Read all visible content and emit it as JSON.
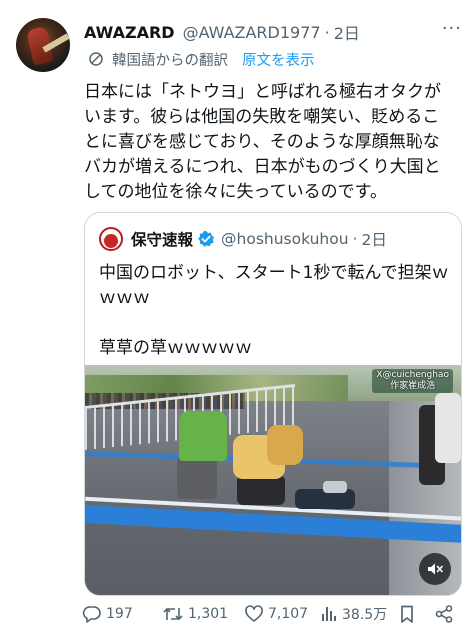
{
  "post": {
    "author_name": "AWAZARD",
    "author_handle": "@AWAZARD1977",
    "separator": "·",
    "time": "2日",
    "more_label": "···",
    "translation_note": "韓国語からの翻訳",
    "show_original": "原文を表示",
    "text": "日本には「ネトウヨ」と呼ばれる極右オタクがいます。彼らは他国の失敗を嘲笑い、貶めることに喜びを感じており、そのような厚顔無恥なバカが増えるにつれ、日本がものづくり大国としての地位を徐々に失っているのです。"
  },
  "quote": {
    "author_name": "保守速報",
    "author_handle": "@hoshusokuhou",
    "separator": "·",
    "time": "2日",
    "text": "中国のロボット、スタート1秒で転んで担架ｗｗｗｗ\n\n草草の草ｗｗｗｗｗ",
    "media": {
      "watermark_line1": "X@cuichenghao",
      "watermark_line2": "作家崔成浩"
    }
  },
  "actions": {
    "replies": "197",
    "reposts": "1,301",
    "likes": "7,107",
    "views": "38.5万"
  },
  "colors": {
    "accent": "#1d9bf0",
    "muted": "#536471",
    "text": "#0f1419",
    "border": "#cfd9de"
  }
}
